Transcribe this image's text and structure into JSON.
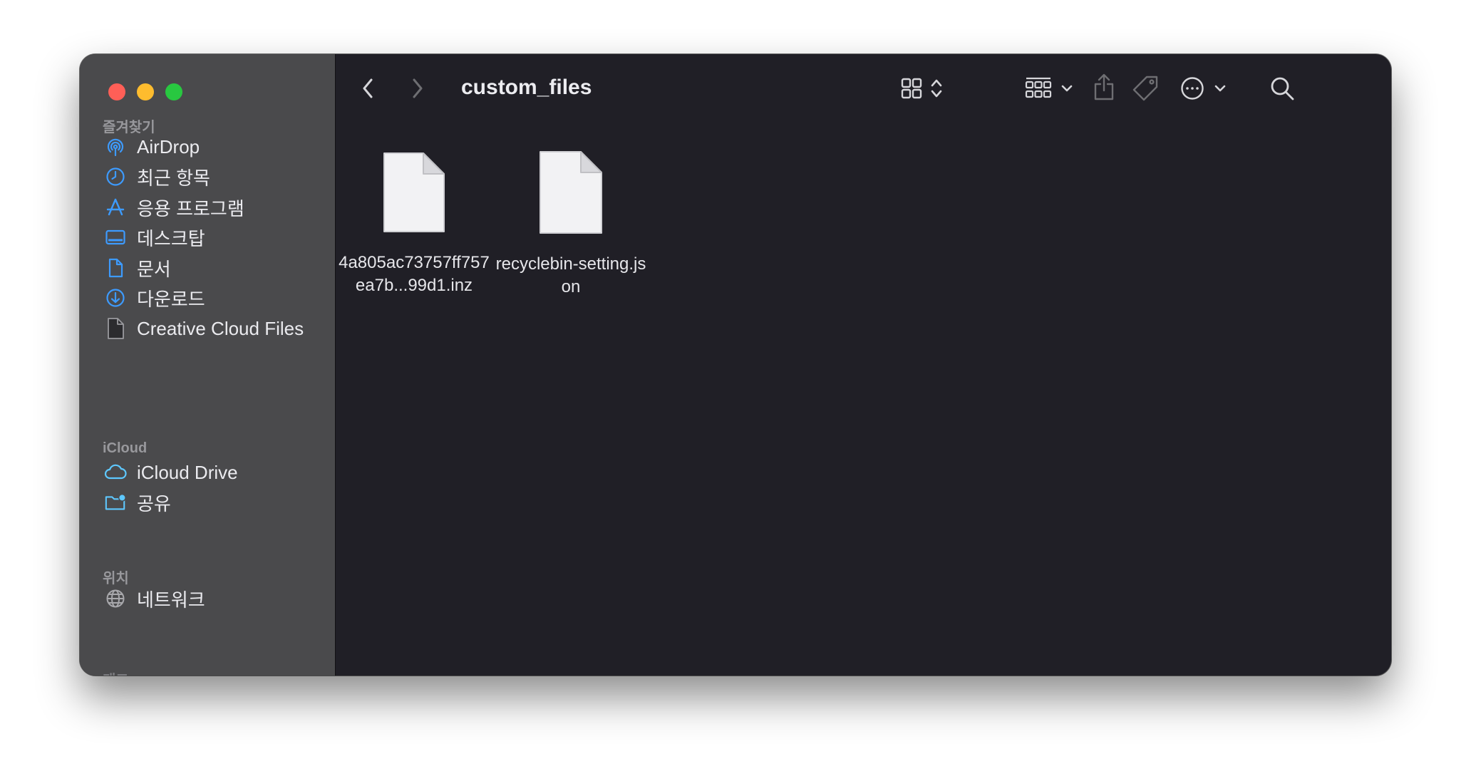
{
  "window": {
    "title": "custom_files"
  },
  "sidebar": {
    "favorites_label": "즐겨찾기",
    "favorites": [
      {
        "label": "AirDrop",
        "icon": "airdrop-icon"
      },
      {
        "label": "최근 항목",
        "icon": "clock-icon"
      },
      {
        "label": "응용 프로그램",
        "icon": "applications-icon"
      },
      {
        "label": "데스크탑",
        "icon": "desktop-icon"
      },
      {
        "label": "문서",
        "icon": "document-icon"
      },
      {
        "label": "다운로드",
        "icon": "download-icon"
      },
      {
        "label": "Creative Cloud Files",
        "icon": "file-icon"
      }
    ],
    "icloud_label": "iCloud",
    "icloud": [
      {
        "label": "iCloud Drive",
        "icon": "cloud-icon"
      },
      {
        "label": "공유",
        "icon": "shared-folder-icon"
      }
    ],
    "locations_label": "위치",
    "locations": [
      {
        "label": "네트워크",
        "icon": "network-globe-icon"
      }
    ]
  },
  "files": [
    {
      "name": "4a805ac73757ff757ea7b...99d1.inz",
      "icon": "document-icon"
    },
    {
      "name": "recyclebin-setting.json",
      "icon": "document-icon"
    }
  ],
  "colors": {
    "sidebar_bg": "#4a4a4c",
    "main_bg": "#201f26",
    "accent_blue": "#3d9bff",
    "close": "#ff5f57",
    "minimize": "#febc2e",
    "maximize": "#28c840"
  }
}
